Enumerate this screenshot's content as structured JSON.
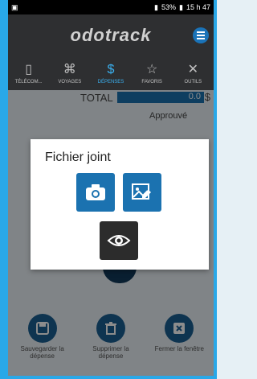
{
  "status_bar": {
    "battery": "53%",
    "time": "15 h 47"
  },
  "header": {
    "logo_text": "odotrack"
  },
  "tabs": [
    {
      "label": "TÉLÉCOM...",
      "icon": "phone-icon",
      "active": false
    },
    {
      "label": "VOYAGES",
      "icon": "map-icon",
      "active": false
    },
    {
      "label": "DÉPENSES",
      "icon": "receipt-icon",
      "active": true
    },
    {
      "label": "FAVORIS",
      "icon": "star-icon",
      "active": false
    },
    {
      "label": "OUTILS",
      "icon": "tools-icon",
      "active": false
    }
  ],
  "content": {
    "total_label": "TOTAL",
    "total_value": "0.0",
    "total_unit": "$",
    "status": "Approuvé"
  },
  "modal": {
    "title": "Fichier joint"
  },
  "actions": [
    {
      "label": "Sauvegarder la dépense",
      "icon": "save-icon"
    },
    {
      "label": "Supprimer la dépense",
      "icon": "trash-icon"
    },
    {
      "label": "Fermer la fenêtre",
      "icon": "close-icon"
    }
  ],
  "colors": {
    "accent": "#29a8e8",
    "button_blue": "#1b72b0",
    "header_dark": "#2e2f31"
  }
}
